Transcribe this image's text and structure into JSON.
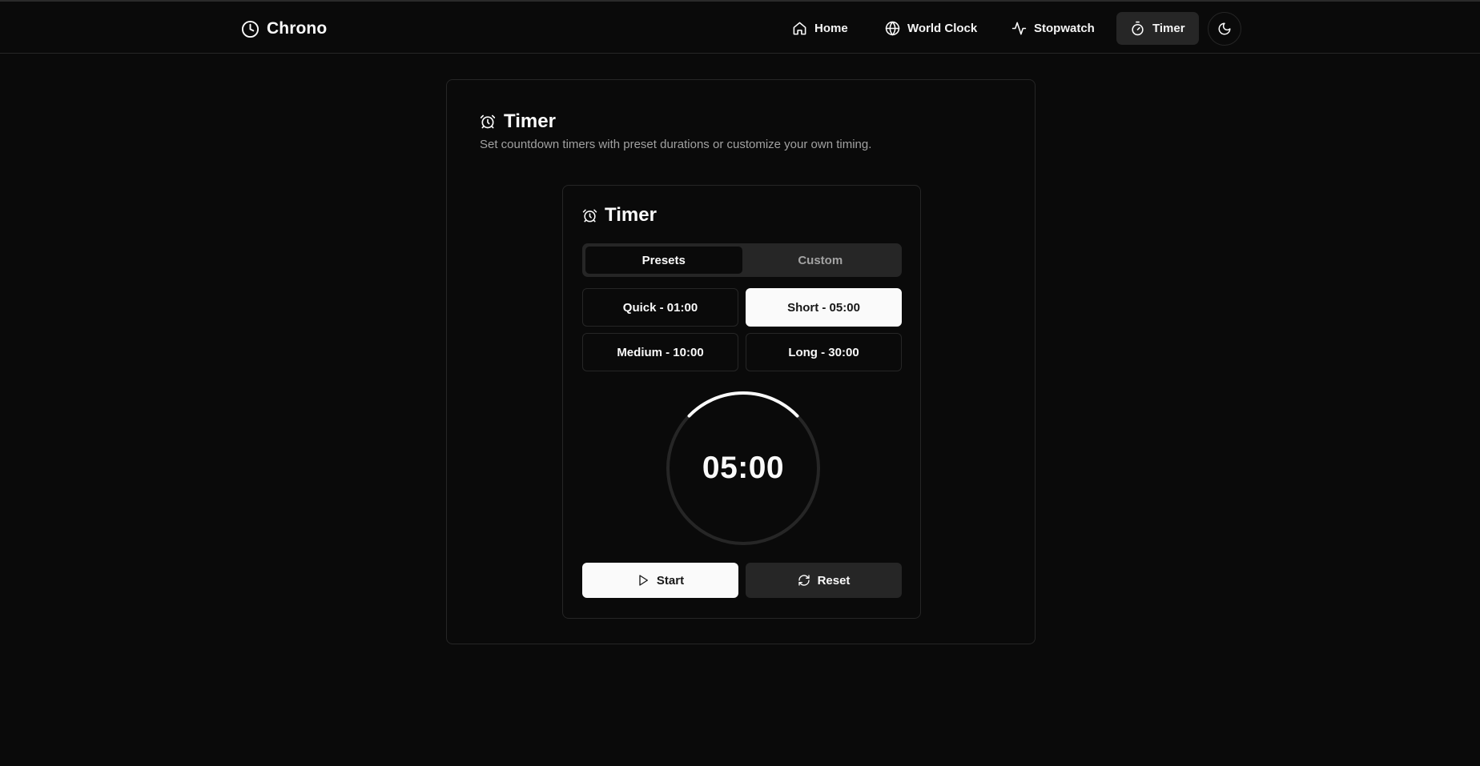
{
  "app": {
    "name": "Chrono"
  },
  "nav": {
    "items": [
      {
        "label": "Home",
        "icon": "home-icon"
      },
      {
        "label": "World Clock",
        "icon": "globe-icon"
      },
      {
        "label": "Stopwatch",
        "icon": "activity-icon"
      },
      {
        "label": "Timer",
        "icon": "timer-icon",
        "active": true
      }
    ],
    "theme_toggle_icon": "moon-icon"
  },
  "page": {
    "title": "Timer",
    "description": "Set countdown timers with preset durations or customize your own timing."
  },
  "timer": {
    "title": "Timer",
    "tabs": [
      {
        "label": "Presets",
        "active": true
      },
      {
        "label": "Custom",
        "active": false
      }
    ],
    "presets": [
      {
        "label": "Quick - 01:00",
        "selected": false
      },
      {
        "label": "Short - 05:00",
        "selected": true
      },
      {
        "label": "Medium - 10:00",
        "selected": false
      },
      {
        "label": "Long - 30:00",
        "selected": false
      }
    ],
    "display": "05:00",
    "start_label": "Start",
    "reset_label": "Reset"
  },
  "colors": {
    "background": "#0a0a0a",
    "border": "#262626",
    "foreground": "#fafafa",
    "muted": "#a1a1a1"
  }
}
